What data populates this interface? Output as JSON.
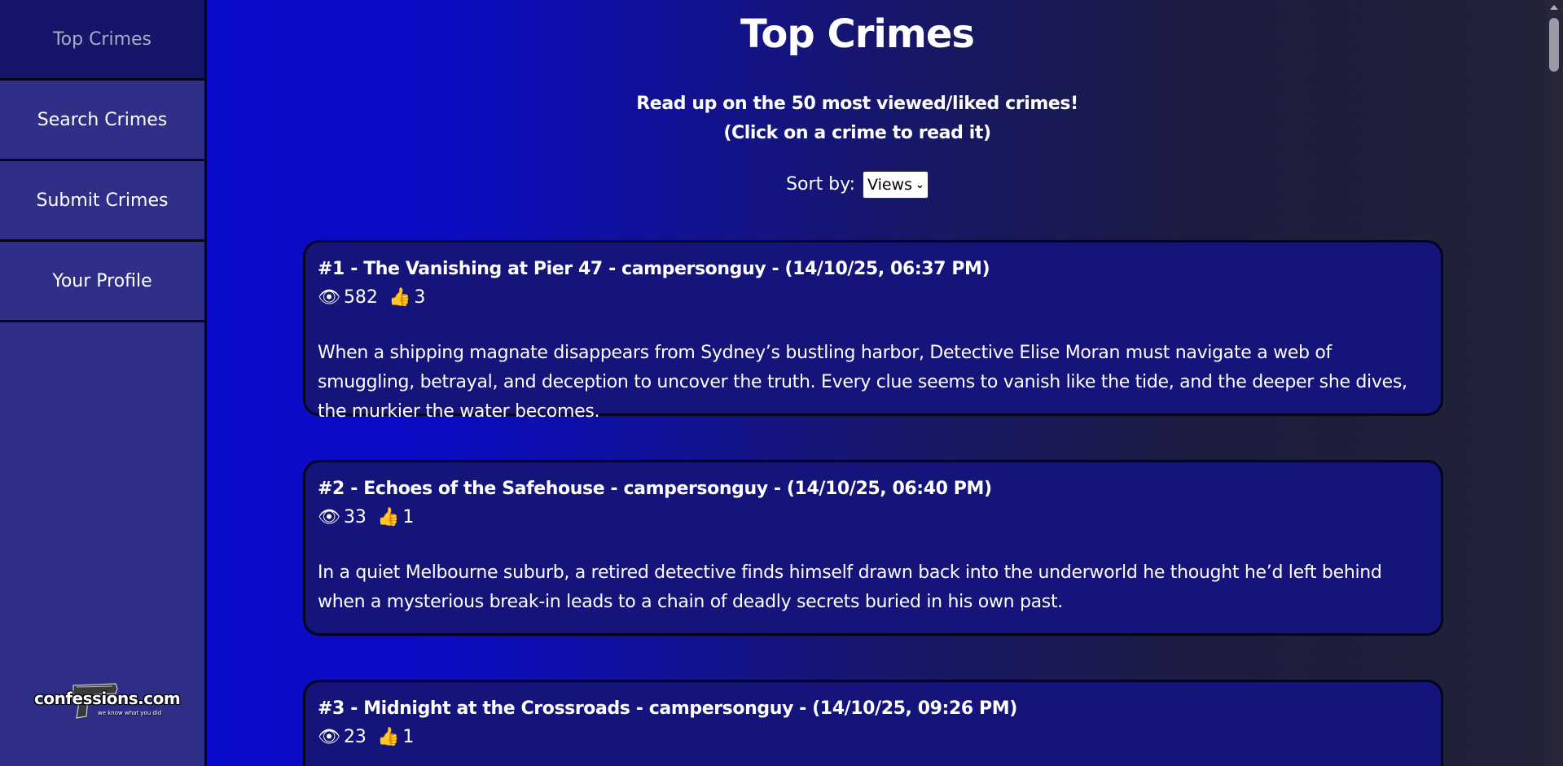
{
  "sidebar": {
    "items": [
      {
        "label": "Top Crimes",
        "active": true
      },
      {
        "label": "Search Crimes",
        "active": false
      },
      {
        "label": "Submit Crimes",
        "active": false
      },
      {
        "label": "Your Profile",
        "active": false
      }
    ],
    "logo": {
      "text": "confessions.com",
      "tagline": "we know what you did",
      "icon": "pistol-icon"
    }
  },
  "main": {
    "title": "Top Crimes",
    "subtitle_line1": "Read up on the 50 most viewed/liked crimes!",
    "subtitle_line2": "(Click on a crime to read it)",
    "sort": {
      "label": "Sort by:",
      "selected": "Views"
    },
    "crimes": [
      {
        "heading": "#1 - The Vanishing at Pier 47 - campersonguy - (14/10/25, 06:37 PM)",
        "views": "582",
        "likes": "3",
        "description": "When a shipping magnate disappears from Sydney’s bustling harbor, Detective Elise Moran must navigate a web of smuggling, betrayal, and deception to uncover the truth. Every clue seems to vanish like the tide, and the deeper she dives, the murkier the water becomes."
      },
      {
        "heading": "#2 - Echoes of the Safehouse - campersonguy - (14/10/25, 06:40 PM)",
        "views": "33",
        "likes": "1",
        "description": "In a quiet Melbourne suburb, a retired detective finds himself drawn back into the underworld he thought he’d left behind when a mysterious break-in leads to a chain of deadly secrets buried in his own past."
      },
      {
        "heading": "#3 - Midnight at the Crossroads - campersonguy - (14/10/25, 09:26 PM)",
        "views": "23",
        "likes": "1"
      }
    ]
  },
  "icons": {
    "views": "👁",
    "likes": "👍"
  },
  "colors": {
    "sidebar_bg": "#2f2f88",
    "sidebar_active_bg": "#15156a",
    "card_bg": "#14147a",
    "gradient_left": "#0b0bd0",
    "gradient_right": "#222238"
  }
}
